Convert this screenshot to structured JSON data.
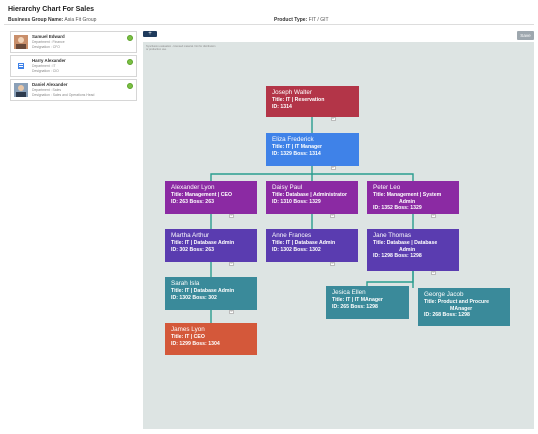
{
  "header": {
    "title": "Hierarchy Chart For Sales",
    "business_group_label": "Business Group Name:",
    "business_group_value": "Asia Fit Group",
    "product_type_label": "Product Type:",
    "product_type_value": "FIT / GIT"
  },
  "toolbar": {
    "add_label": "+",
    "save_label": "Save"
  },
  "watermark": "Syncfusion evaluation - licensed material. Not for distribution or production use.",
  "sidebar": {
    "employees": [
      {
        "name": "Samuel Edward",
        "department": "Department : Finance",
        "designation": "Designation : CFO",
        "photo": "photo-samuel"
      },
      {
        "name": "Harry Alexander",
        "department": "Department : IT",
        "designation": "Designation : CIO",
        "photo": "photo-harry"
      },
      {
        "name": "Daniel Alexander",
        "department": "Department : Sales",
        "designation": "Designation : Sales and Operations Head",
        "photo": "photo-daniel"
      }
    ]
  },
  "nodes": [
    {
      "id": "joseph",
      "name": "Joseph Walter",
      "line1": "Title:  IT  |  Reservation",
      "line2": "ID:  1314",
      "color": "#b33548"
    },
    {
      "id": "eliza",
      "name": "Eliza Frederick",
      "line1": "Title:  IT  |  IT Manager",
      "line2": "ID:  1329   Boss:  1314",
      "color": "#3f82e8"
    },
    {
      "id": "alexander",
      "name": "Alexander Lyon",
      "line1": "Title:  Management  |  CEO",
      "line2": "ID:  263  Boss:  263",
      "color": "#8b2aa3"
    },
    {
      "id": "daisy",
      "name": "Daisy Paul",
      "line1": "Title:  Database  |  Administrator",
      "line2": "ID:  1310  Boss:  1329",
      "color": "#8b2aa3"
    },
    {
      "id": "peter",
      "name": "Peter Leo",
      "line1": "Title:  Management  |  System",
      "line2": "Admin",
      "line3": "ID:  1352  Boss:  1329",
      "color": "#8b2aa3"
    },
    {
      "id": "martha",
      "name": "Martha Arthur",
      "line1": "Title:  IT  |  Database Admin",
      "line2": "ID:  302  Boss:  263",
      "color": "#5a3cb0"
    },
    {
      "id": "anne",
      "name": "Anne Frances",
      "line1": "Title:  IT  |  Database Admin",
      "line2": "ID:  1302  Boss:  1302",
      "color": "#5a3cb0"
    },
    {
      "id": "jane",
      "name": "Jane Thomas",
      "line1": "Title:  Database  |  Database",
      "line2": "Admin",
      "line3": "ID:  1298  Boss:  1298",
      "color": "#5a3cb0"
    },
    {
      "id": "sarah",
      "name": "Sarah Isla",
      "line1": "Title:  IT  |  Database Admin",
      "line2": "ID:  1302  Boss:  302",
      "color": "#3a8a9a"
    },
    {
      "id": "jesica",
      "name": "Jesica Ellen",
      "line1": "Title:  IT  |  IT MAnager",
      "line2": "ID:  265  Boss:  1298",
      "color": "#3a8a9a"
    },
    {
      "id": "george",
      "name": "George Jacob",
      "line1": "Title:  Product and Procure",
      "line2": "MAnager",
      "line3": "ID:  268  Boss:  1298",
      "color": "#3a8a9a"
    },
    {
      "id": "james",
      "name": "James Lyon",
      "line1": "Title:  IT  |  CEO",
      "line2": "ID:  1299  Boss:  1304",
      "color": "#d4583a"
    }
  ],
  "connector_color": "#2a9d8f"
}
